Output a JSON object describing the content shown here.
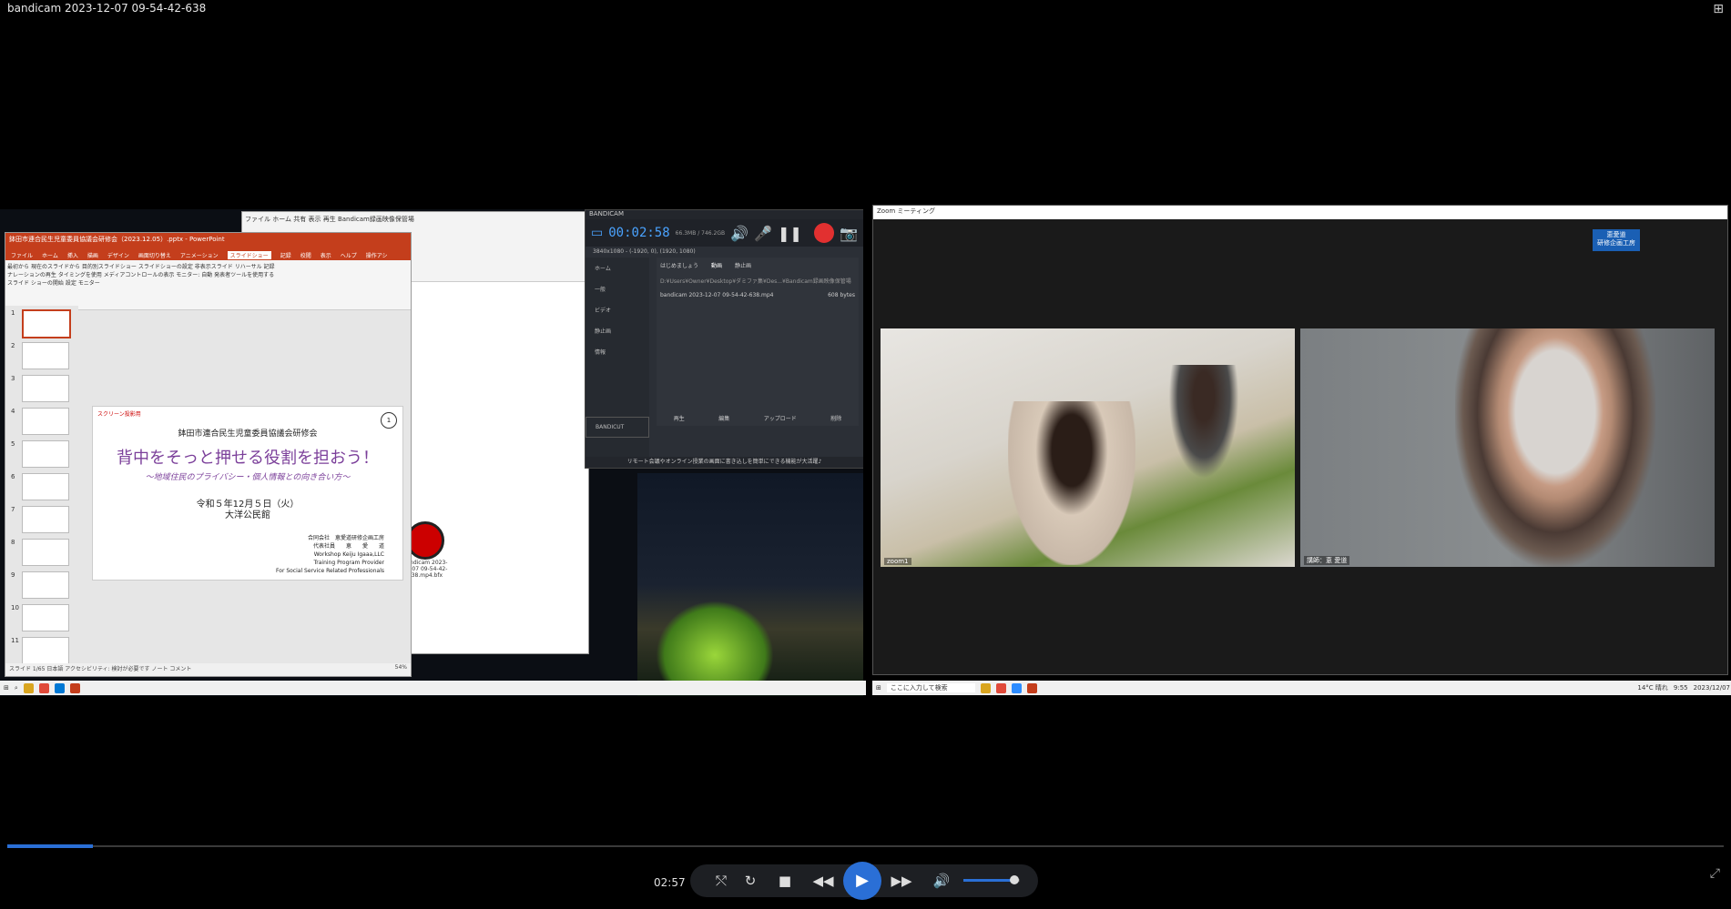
{
  "window": {
    "title": "bandicam 2023-12-07 09-54-42-638",
    "menu_icon": "grid-icon"
  },
  "explorer": {
    "tab_file": "ファイル",
    "tab_home": "ホーム",
    "tab_share": "共有",
    "tab_view": "表示",
    "play_tab": "再生",
    "path": "Bandicam録画映像保管場",
    "file_label": "bandicam 2023-12-07 09-54-42-638.mp4.bfx"
  },
  "ppt": {
    "title": "鉢田市連合民生児童委員協議会研修会（2023.12.05）.pptx - PowerPoint",
    "tabs": [
      "ファイル",
      "ホーム",
      "挿入",
      "描画",
      "デザイン",
      "画面切り替え",
      "アニメーション",
      "スライドショー",
      "記録",
      "校閲",
      "表示",
      "ヘルプ",
      "操作アシ"
    ],
    "ribbon": {
      "from_start": "最初から",
      "from_current": "現在のスライドから",
      "custom": "目的別スライドショー",
      "setup": "スライドショーの設定",
      "hide": "非表示スライド",
      "rehearse": "リハーサル",
      "record": "記録",
      "narration": "ナレーションの再生",
      "timings": "タイミングを使用",
      "media": "メディアコントロールの表示",
      "monitor": "モニター:",
      "monitor_value": "自動",
      "presenter": "発表者ツールを使用する",
      "group1": "スライド ショーの開始",
      "group2": "設定",
      "group3": "モニター"
    },
    "slide": {
      "badge": "スクリーン投影用",
      "org": "鉢田市連合民生児童委員協議会研修会",
      "main": "背中をそっと押せる役割を担おう！",
      "sub": "～地域住民のプライバシー・個人情報との向き合い方～",
      "date": "令和５年12月５日（火）",
      "place": "大洋公民館",
      "credit1": "合同会社　恵愛道研修企画工房",
      "credit2": "代表社員　　恵　　愛　　道",
      "credit3": "Workshop Keiju Igaaa,LLC",
      "credit4": "Training Program Provider",
      "credit5": "For Social Service Related Professionals",
      "number": "1"
    },
    "thumb_numbers": [
      "1",
      "2",
      "3",
      "4",
      "5",
      "6",
      "7",
      "8",
      "9",
      "10",
      "11"
    ],
    "status": {
      "slide": "スライド 1/65",
      "lang": "日本語",
      "access": "アクセシビリティ: 検討が必要です",
      "notes": "ノート",
      "comments": "コメント",
      "zoom": "54%"
    }
  },
  "bandicam": {
    "brand": "BANDICAM",
    "time": "00:02:58",
    "size": "66.3MB / 746.2GB",
    "res": "3840x1080 - (-1920, 0), (1920, 1080)",
    "nav": [
      "ホーム",
      "一般",
      "ビデオ",
      "静止画",
      "情報"
    ],
    "tabs": [
      "はじめましょう",
      "動画",
      "静止画"
    ],
    "path": "D:¥Users¥Owner¥Desktop¥ダミファ集¥Des...¥Bandicam録画映像保管場",
    "file": "bandicam 2023-12-07 09-54-42-638.mp4",
    "file_size": "608 bytes",
    "actions": [
      "再生",
      "編集",
      "アップロード",
      "削除"
    ],
    "bandicut": "BANDICUT",
    "footer": "リモート会議やオンライン授業の画面に書き込しを簡単にできる機能が大活躍♪"
  },
  "zoom": {
    "title": "Zoom ミーティング",
    "tag_line1": "恵愛道",
    "tag_line2": "研修企画工房",
    "video1_label": "zoom1",
    "video2_label": "講師：恵 愛道"
  },
  "taskbar": {
    "search": "ここに入力して検索",
    "weather": "14°C 晴れ",
    "clock": "9:55",
    "date": "2023/12/07"
  },
  "player": {
    "time": "02:57",
    "progress": 0.05,
    "volume": 0.9
  }
}
